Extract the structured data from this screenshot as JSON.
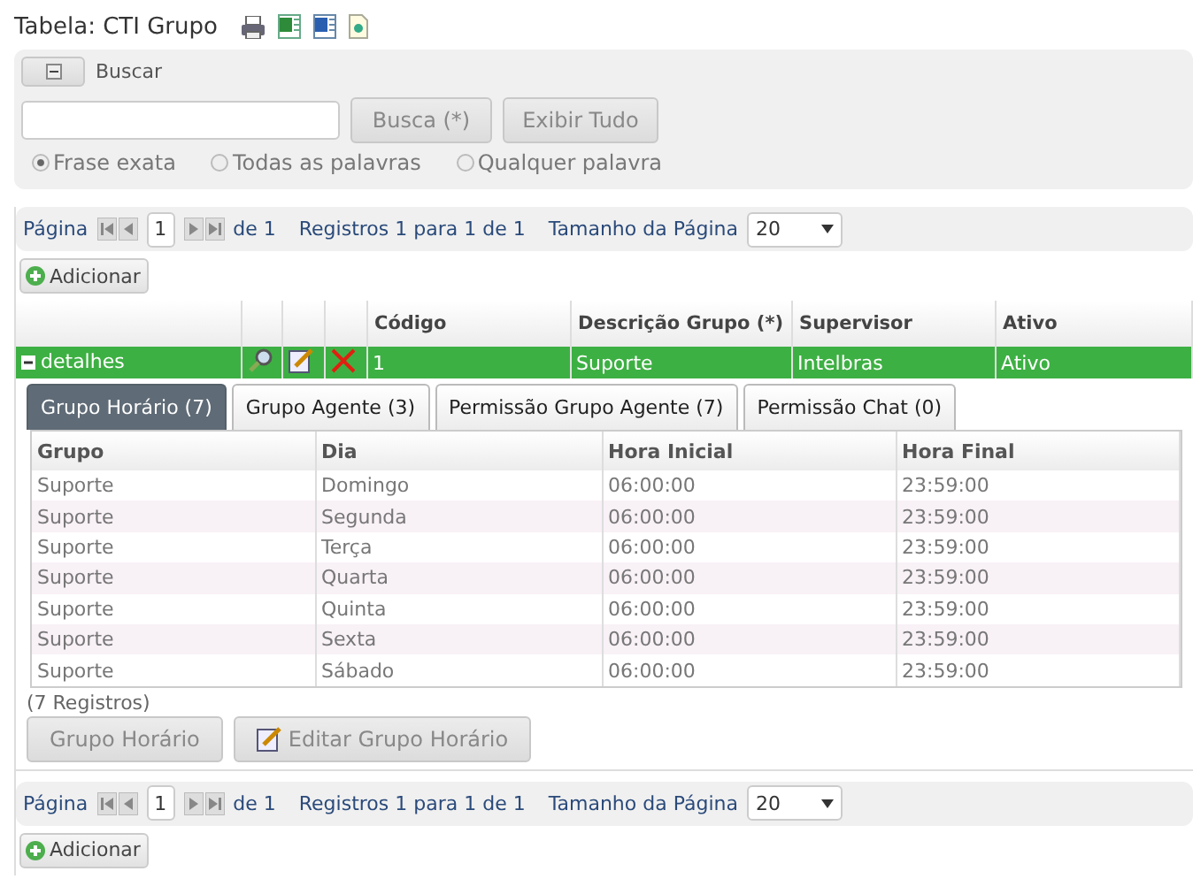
{
  "title": "Tabela: CTI Grupo",
  "search": {
    "toggle_label": "Buscar",
    "buttons": [
      "Busca (*)",
      "Exibir Tudo"
    ],
    "options": [
      {
        "label": "Frase exata",
        "selected": true
      },
      {
        "label": "Todas as palavras",
        "selected": false
      },
      {
        "label": "Qualquer palavra",
        "selected": false
      }
    ]
  },
  "pagers": [
    {
      "label": "Página",
      "page": "1",
      "of": "de 1",
      "records": "Registros 1 para 1 de 1",
      "size_label": "Tamanho da Página",
      "size": "20",
      "add": "Adicionar"
    },
    {
      "label": "Página",
      "page": "1",
      "of": "de 1",
      "records": "Registros 1 para 1 de 1",
      "size_label": "Tamanho da Página",
      "size": "20",
      "add": "Adicionar"
    }
  ],
  "table": {
    "columns": [
      "Código",
      "Descrição Grupo (*)",
      "Supervisor",
      "Ativo"
    ],
    "rows": [
      {
        "toggle": "detalhes",
        "expanded": true,
        "selected": true,
        "cells": [
          "1",
          "Suporte",
          "Intelbras",
          "Ativo"
        ]
      }
    ]
  },
  "detail": {
    "tabs": [
      {
        "label": "Grupo Horário (7)",
        "selected": true
      },
      {
        "label": "Grupo Agente (3)",
        "selected": false
      },
      {
        "label": "Permissão Grupo Agente (7)",
        "selected": false
      },
      {
        "label": "Permissão Chat (0)",
        "selected": false
      }
    ],
    "columns": [
      "Grupo",
      "Dia",
      "Hora Inicial",
      "Hora Final"
    ],
    "rows": [
      [
        "Suporte",
        "Domingo",
        "06:00:00",
        "23:59:00"
      ],
      [
        "Suporte",
        "Segunda",
        "06:00:00",
        "23:59:00"
      ],
      [
        "Suporte",
        "Terça",
        "06:00:00",
        "23:59:00"
      ],
      [
        "Suporte",
        "Quarta",
        "06:00:00",
        "23:59:00"
      ],
      [
        "Suporte",
        "Quinta",
        "06:00:00",
        "23:59:00"
      ],
      [
        "Suporte",
        "Sexta",
        "06:00:00",
        "23:59:00"
      ],
      [
        "Suporte",
        "Sábado",
        "06:00:00",
        "23:59:00"
      ]
    ],
    "count": "(7 Registros)",
    "buttons": [
      {
        "label": "Grupo Horário",
        "kind": "plain"
      },
      {
        "label": "Editar Grupo Horário",
        "kind": "edit"
      }
    ]
  }
}
